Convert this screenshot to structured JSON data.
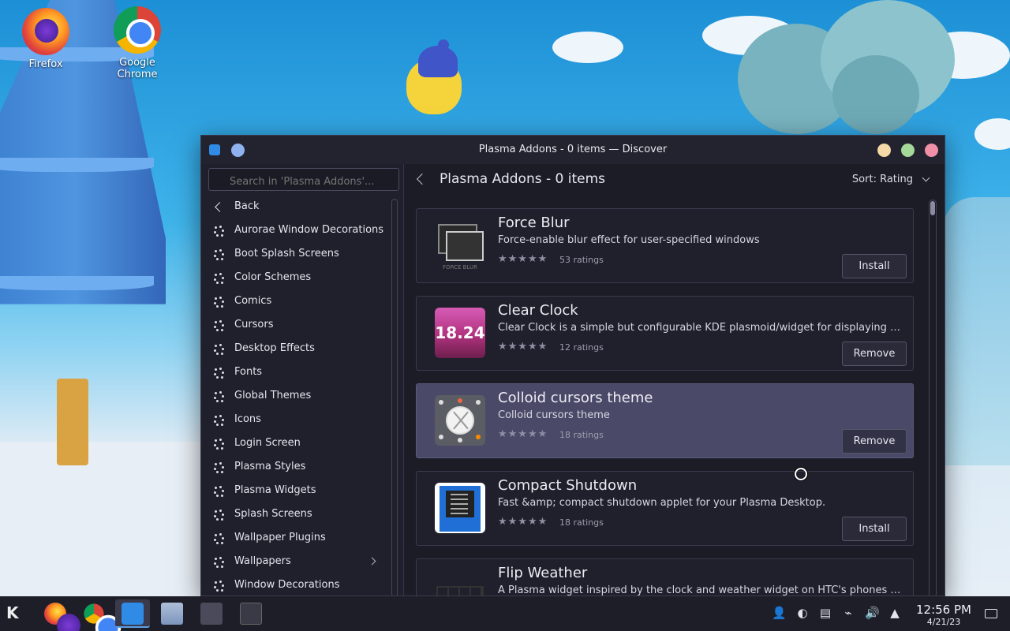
{
  "desktop": {
    "icons": [
      {
        "label": "Firefox",
        "icon": "firefox-icon"
      },
      {
        "label": "Google Chrome",
        "icon": "chrome-icon"
      }
    ]
  },
  "window": {
    "title": "Plasma Addons - 0 items — Discover",
    "search_placeholder": "Search in 'Plasma Addons'...",
    "sidebar": {
      "back_label": "Back",
      "items": [
        {
          "label": "Aurorae Window Decorations"
        },
        {
          "label": "Boot Splash Screens"
        },
        {
          "label": "Color Schemes"
        },
        {
          "label": "Comics"
        },
        {
          "label": "Cursors"
        },
        {
          "label": "Desktop Effects"
        },
        {
          "label": "Fonts"
        },
        {
          "label": "Global Themes"
        },
        {
          "label": "Icons"
        },
        {
          "label": "Login Screen"
        },
        {
          "label": "Plasma Styles"
        },
        {
          "label": "Plasma Widgets"
        },
        {
          "label": "Splash Screens"
        },
        {
          "label": "Wallpaper Plugins"
        },
        {
          "label": "Wallpapers",
          "has_submenu": true
        },
        {
          "label": "Window Decorations"
        }
      ]
    },
    "header": {
      "title": "Plasma Addons - 0 items",
      "sort_label": "Sort: Rating"
    },
    "addons": [
      {
        "title": "Force Blur",
        "description": "Force-enable blur effect for user-specified windows",
        "stars": 5,
        "ratings": "53 ratings",
        "action": "Install",
        "thumb_label": "FORCE BLUR"
      },
      {
        "title": "Clear Clock",
        "description": "Clear Clock is a simple but configurable KDE plasmoid/widget for displaying date a...",
        "stars": 4,
        "ratings": "12 ratings",
        "action": "Remove",
        "thumb_label": "18.24"
      },
      {
        "title": "Colloid cursors theme",
        "description": "Colloid cursors theme",
        "stars": 4,
        "ratings": "18 ratings",
        "action": "Remove",
        "highlighted": true
      },
      {
        "title": "Compact Shutdown",
        "description": "Fast &amp; compact shutdown applet for your Plasma Desktop.",
        "stars": 4,
        "ratings": "18 ratings",
        "action": "Install"
      },
      {
        "title": "Flip Weather",
        "description": "A Plasma widget inspired by the clock and weather widget on HTC's phones and tab..."
      }
    ]
  },
  "taskbar": {
    "items": [
      "kde-menu-icon",
      "firefox-icon",
      "chrome-icon",
      "discover-icon",
      "files-icon",
      "system-settings-icon",
      "terminal-icon"
    ],
    "active": "discover-icon",
    "time": "12:56 PM",
    "date": "4/21/23"
  },
  "colors": {
    "window_bg": "#1f1f2b",
    "highlight": "#4a4a68",
    "accent": "#5aa0e6"
  }
}
